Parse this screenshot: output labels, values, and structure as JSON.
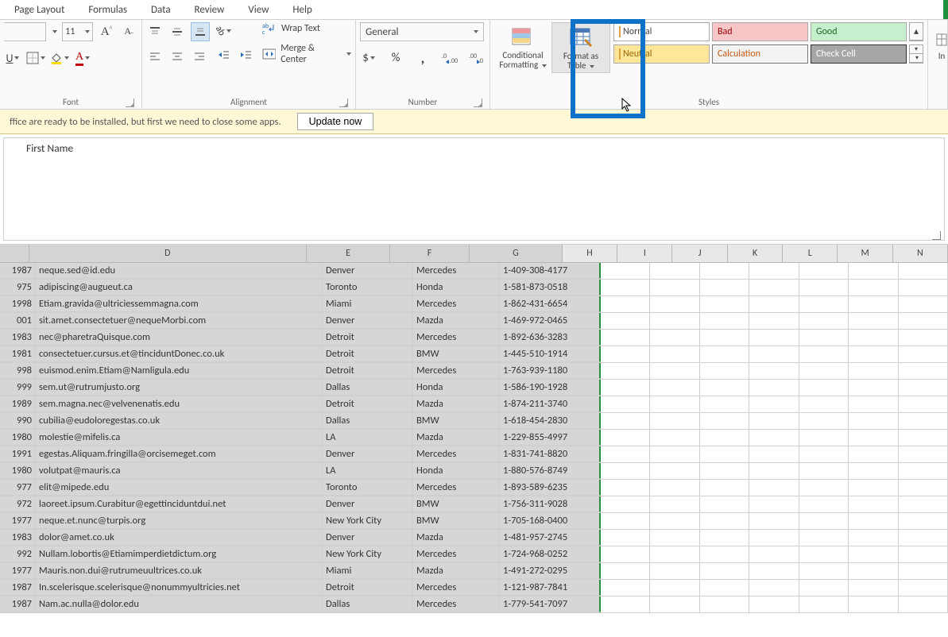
{
  "menu": {
    "page_layout": "Page Layout",
    "formulas": "Formulas",
    "data": "Data",
    "review": "Review",
    "view": "View",
    "help": "Help"
  },
  "ribbon": {
    "font_size": "11",
    "font_group": "Font",
    "align_group": "Alignment",
    "number_group": "Number",
    "styles_group": "Styles",
    "wrap_text": "Wrap Text",
    "merge_center": "Merge & Center",
    "number_format": "General",
    "cond_fmt_line1": "Conditional",
    "cond_fmt_line2": "Formatting",
    "fmt_tbl_line1": "Format as",
    "fmt_tbl_line2": "Table",
    "style_normal": "Normal",
    "style_bad": "Bad",
    "style_good": "Good",
    "style_neutral": "Neutral",
    "style_calc": "Calculation",
    "style_check": "Check Cell",
    "insert_label": "In"
  },
  "message_bar": {
    "text": "ffice are ready to be installed, but first we need to close some apps.",
    "button": "Update now"
  },
  "formula_bar": {
    "value": "First Name"
  },
  "columns": [
    "D",
    "E",
    "F",
    "G",
    "H",
    "I",
    "J",
    "K",
    "L",
    "M",
    "N"
  ],
  "rows": [
    {
      "c": "1987",
      "d": "neque.sed@id.edu",
      "e": "Denver",
      "f": "Mercedes",
      "g": "1-409-308-4177"
    },
    {
      "c": "975",
      "d": "adipiscing@augueut.ca",
      "e": "Toronto",
      "f": "Honda",
      "g": "1-581-873-0518"
    },
    {
      "c": "1998",
      "d": "Etiam.gravida@ultriciessemmagna.com",
      "e": "Miami",
      "f": "Mercedes",
      "g": "1-862-431-6654"
    },
    {
      "c": "001",
      "d": "sit.amet.consectetuer@nequeMorbi.com",
      "e": "Denver",
      "f": "Mazda",
      "g": "1-469-972-0465"
    },
    {
      "c": "1983",
      "d": "nec@pharetraQuisque.com",
      "e": "Detroit",
      "f": "Mercedes",
      "g": "1-892-636-3283"
    },
    {
      "c": "1981",
      "d": "consectetuer.cursus.et@tinciduntDonec.co.uk",
      "e": "Detroit",
      "f": "BMW",
      "g": "1-445-510-1914"
    },
    {
      "c": "998",
      "d": "euismod.enim.Etiam@Namligula.edu",
      "e": "Detroit",
      "f": "Mercedes",
      "g": "1-763-939-1180"
    },
    {
      "c": "999",
      "d": "sem.ut@rutrumjusto.org",
      "e": "Dallas",
      "f": "Honda",
      "g": "1-586-190-1928"
    },
    {
      "c": "1989",
      "d": "sem.magna.nec@velvenenatis.edu",
      "e": "Detroit",
      "f": "Mazda",
      "g": "1-874-211-3740"
    },
    {
      "c": "990",
      "d": "cubilia@eudoloregestas.co.uk",
      "e": "Dallas",
      "f": "BMW",
      "g": "1-618-454-2830"
    },
    {
      "c": "1980",
      "d": "molestie@mifelis.ca",
      "e": "LA",
      "f": "Mazda",
      "g": "1-229-855-4997"
    },
    {
      "c": "1991",
      "d": "egestas.Aliquam.fringilla@orcisemeget.com",
      "e": "Denver",
      "f": "Mercedes",
      "g": "1-831-741-8820"
    },
    {
      "c": "1980",
      "d": "volutpat@mauris.ca",
      "e": "LA",
      "f": "Honda",
      "g": "1-880-576-8749"
    },
    {
      "c": "977",
      "d": "elit@mipede.edu",
      "e": "Toronto",
      "f": "Mercedes",
      "g": "1-893-589-6235"
    },
    {
      "c": "972",
      "d": "laoreet.ipsum.Curabitur@egettinciduntdui.net",
      "e": "Denver",
      "f": "BMW",
      "g": "1-756-311-9028"
    },
    {
      "c": "1977",
      "d": "neque.et.nunc@turpis.org",
      "e": "New York City",
      "f": "BMW",
      "g": "1-705-168-0400"
    },
    {
      "c": "1983",
      "d": "dolor@amet.co.uk",
      "e": "Denver",
      "f": "Mazda",
      "g": "1-481-957-2745"
    },
    {
      "c": "992",
      "d": "Nullam.lobortis@Etiamimperdietdictum.org",
      "e": "New York City",
      "f": "Mercedes",
      "g": "1-724-968-0252"
    },
    {
      "c": "1977",
      "d": "Mauris.non.dui@rutrumeuultrices.co.uk",
      "e": "Miami",
      "f": "Mazda",
      "g": "1-491-272-0295"
    },
    {
      "c": "1987",
      "d": "In.scelerisque.scelerisque@nonummyultricies.net",
      "e": "Detroit",
      "f": "Mercedes",
      "g": "1-121-987-7841"
    },
    {
      "c": "1987",
      "d": "Nam.ac.nulla@dolor.edu",
      "e": "Dallas",
      "f": "Mercedes",
      "g": "1-779-541-7097"
    }
  ]
}
